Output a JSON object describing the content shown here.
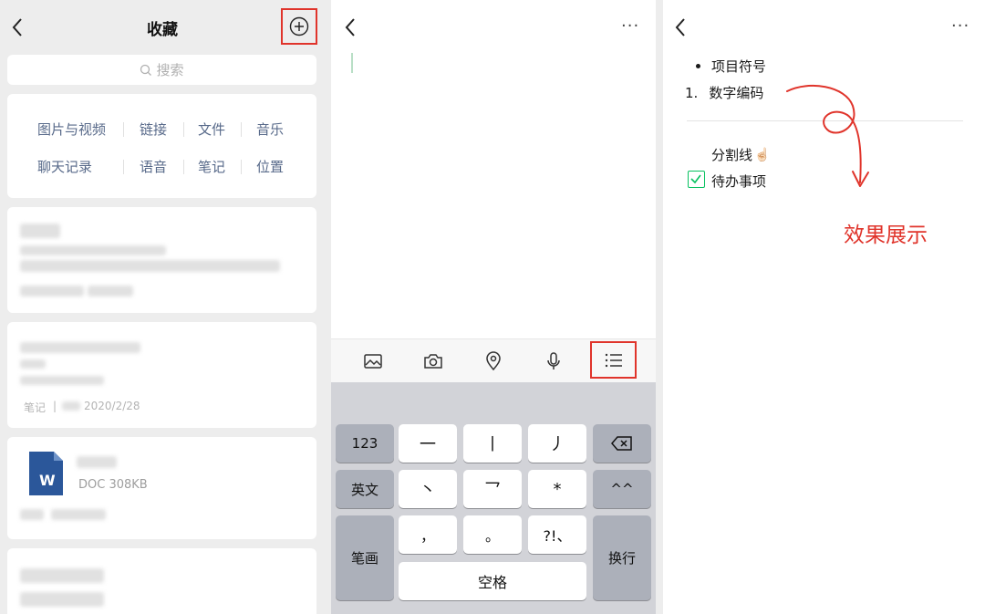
{
  "collections": {
    "title": "收藏",
    "search_placeholder": "搜索",
    "categories": [
      "图片与视频",
      "链接",
      "文件",
      "音乐",
      "聊天记录",
      "语音",
      "笔记",
      "位置"
    ],
    "note_card": {
      "type_label": "笔记",
      "separator": "|",
      "date": "2020/2/28"
    },
    "doc_card": {
      "icon_letter": "W",
      "meta": "DOC 308KB"
    }
  },
  "editor": {
    "more_label": "···",
    "toolbar_icons": [
      "image-icon",
      "camera-icon",
      "location-icon",
      "microphone-icon",
      "list-icon"
    ],
    "keyboard": {
      "keys": {
        "num": "123",
        "h": "一",
        "s": "丨",
        "p": "丿",
        "lang": "英文",
        "d": "丶",
        "z": "乛",
        "star": "*",
        "emoji": "^^",
        "stroke": "笔画",
        "comma": "，",
        "period": "。",
        "punct": "?!、",
        "space": "空格",
        "enter": "换行"
      }
    }
  },
  "preview": {
    "more_label": "···",
    "bullet_item": "项目符号",
    "number_marker": "1.",
    "numbered_item": "数字编码",
    "divider_label": "分割线",
    "divider_emoji": "☝🏻",
    "todo_item": "待办事项",
    "annotation": "效果展示"
  },
  "colors": {
    "highlight_red": "#e0342b",
    "category_text": "#586a8a",
    "check_green": "#07c160",
    "word_blue": "#2b579a"
  }
}
